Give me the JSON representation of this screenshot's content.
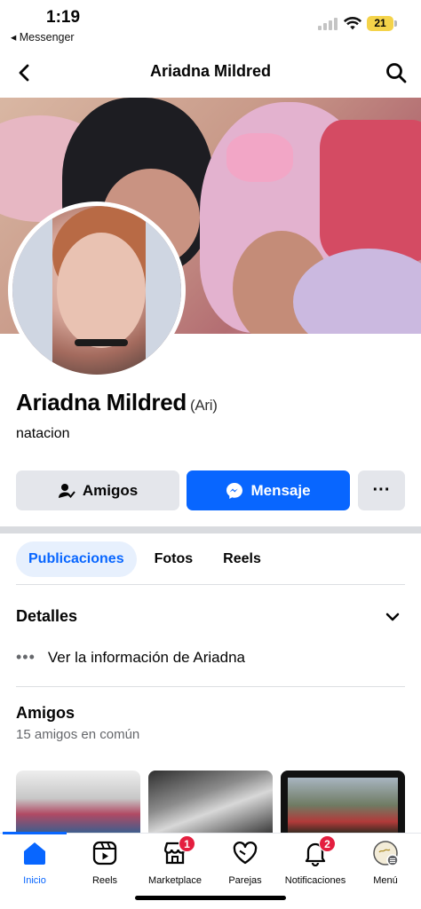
{
  "status": {
    "time": "1:19",
    "back_app": "◂ Messenger",
    "battery": "21"
  },
  "header": {
    "title": "Ariadna Mildred"
  },
  "profile": {
    "name": "Ariadna Mildred",
    "nickname": "(Ari)",
    "bio": "natacion"
  },
  "actions": {
    "friends_label": "Amigos",
    "message_label": "Mensaje",
    "more_label": "···"
  },
  "tabs": [
    {
      "label": "Publicaciones",
      "active": true
    },
    {
      "label": "Fotos",
      "active": false
    },
    {
      "label": "Reels",
      "active": false
    }
  ],
  "details": {
    "title": "Detalles",
    "info_link": "Ver la información de Ariadna"
  },
  "friends": {
    "title": "Amigos",
    "mutual": "15 amigos en común"
  },
  "bottom_nav": [
    {
      "label": "Inicio",
      "icon": "home-icon",
      "active": true,
      "badge": ""
    },
    {
      "label": "Reels",
      "icon": "reels-icon",
      "active": false,
      "badge": ""
    },
    {
      "label": "Marketplace",
      "icon": "marketplace-icon",
      "active": false,
      "badge": "1"
    },
    {
      "label": "Parejas",
      "icon": "dating-heart-icon",
      "active": false,
      "badge": ""
    },
    {
      "label": "Notificaciones",
      "icon": "bell-icon",
      "active": false,
      "badge": "2"
    },
    {
      "label": "Menú",
      "icon": "menu-avatar-icon",
      "active": false,
      "badge": ""
    }
  ],
  "colors": {
    "accent": "#0866ff",
    "badge": "#e41e3f",
    "secondary_button": "#e4e6eb"
  }
}
